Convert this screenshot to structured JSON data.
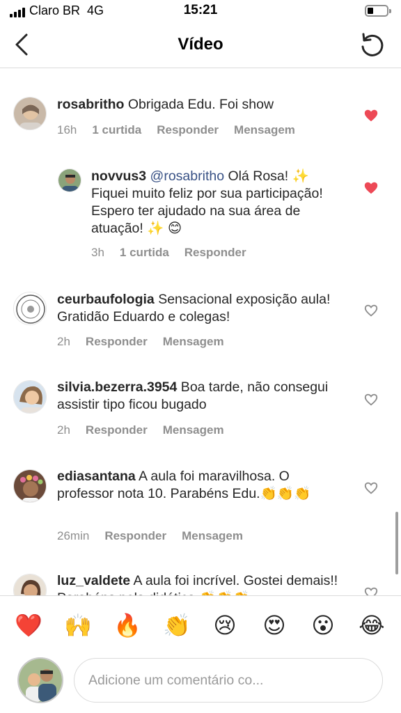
{
  "status_bar": {
    "carrier": "Claro BR",
    "network": "4G",
    "time": "15:21"
  },
  "header": {
    "title": "Vídeo",
    "back_icon": "chevron-left-icon",
    "refresh_icon": "refresh-icon"
  },
  "comments": [
    {
      "username": "rosabritho",
      "text": " Obrigada  Edu. Foi show",
      "time": "16h",
      "likes": "1 curtida",
      "reply_label": "Responder",
      "message_label": "Mensagem",
      "liked": true
    },
    {
      "username": "novvus3",
      "mention": "@rosabritho",
      "text": " Olá Rosa! ✨ Fiquei muito feliz por sua participação! Espero ter ajudado na sua área de atuação! ✨ 😊",
      "time": "3h",
      "likes": "1 curtida",
      "reply_label": "Responder",
      "liked": true
    },
    {
      "username": "ceurbaufologia",
      "text": " Sensacional exposição aula! Gratidão Eduardo e colegas!",
      "time": "2h",
      "reply_label": "Responder",
      "message_label": "Mensagem",
      "liked": false
    },
    {
      "username": "silvia.bezerra.3954",
      "text": " Boa tarde, não consegui assistir tipo ficou bugado",
      "time": "2h",
      "reply_label": "Responder",
      "message_label": "Mensagem",
      "liked": false
    },
    {
      "username": "ediasantana",
      "text": " A aula foi maravilhosa. O professor nota 10. Parabéns Edu.👏👏👏",
      "time": "26min",
      "reply_label": "Responder",
      "message_label": "Mensagem",
      "liked": false
    },
    {
      "username": "luz_valdete",
      "text": " A aula foi incrível. Gostei demais!! Parabéns pela didática 👏👏👏",
      "liked": false
    }
  ],
  "emoji_bar": [
    "❤️",
    "🙌",
    "🔥",
    "👏",
    "😢",
    "😍",
    "😮",
    "😂"
  ],
  "composer": {
    "placeholder": "Adicione um comentário co..."
  },
  "colors": {
    "like_active": "#ed4956",
    "meta_text": "#8e8e8e",
    "mention": "#385185",
    "divider": "#dbdbdb"
  }
}
